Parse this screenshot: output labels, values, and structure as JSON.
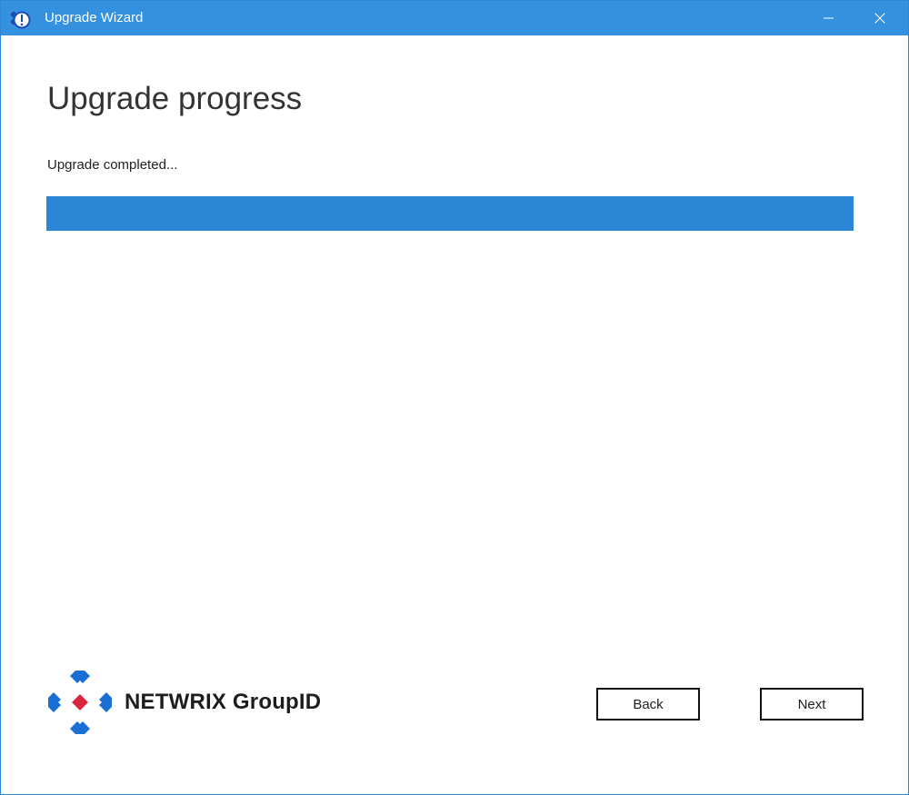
{
  "window": {
    "title": "Upgrade Wizard",
    "app_icon": "wizard-app-icon",
    "controls": {
      "minimize_icon": "minimize-icon",
      "close_icon": "close-icon"
    }
  },
  "page": {
    "heading": "Upgrade progress",
    "status": "Upgrade completed...",
    "progress_percent": 100
  },
  "brand": {
    "logo_icon": "netwrix-logo-icon",
    "name": "NETWRIX GroupID"
  },
  "buttons": {
    "back_label": "Back",
    "next_label": "Next"
  },
  "colors": {
    "titlebar": "#3391e0",
    "progress": "#2b86d6",
    "logo_blue": "#1a6fd4",
    "logo_red": "#d7263d"
  }
}
